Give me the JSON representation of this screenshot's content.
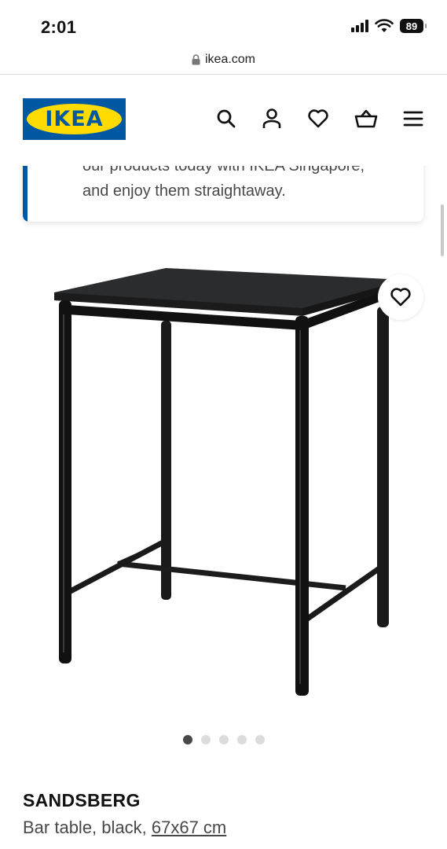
{
  "status_bar": {
    "time": "2:01",
    "battery": "89"
  },
  "browser": {
    "url": "ikea.com"
  },
  "header": {
    "logo_text": "IKEA"
  },
  "banner": {
    "line1": "our products today with IKEA Singapore,",
    "line2": "and enjoy them straightaway."
  },
  "carousel": {
    "total": 5,
    "active_index": 0
  },
  "product": {
    "name": "SANDSBERG",
    "description": "Bar table, black,",
    "size": "67x67 cm"
  },
  "colors": {
    "brand_blue": "#0058a3",
    "brand_yellow": "#ffdb00"
  }
}
